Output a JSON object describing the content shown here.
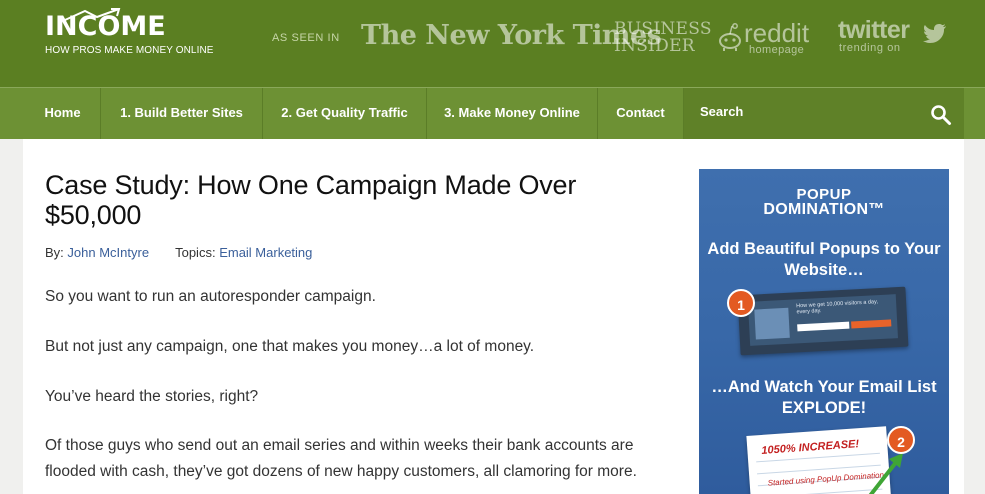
{
  "header": {
    "logo_text": "INCOME",
    "logo_tagline": "HOW PROS MAKE MONEY ONLINE",
    "as_seen_in": "AS SEEN IN",
    "press": {
      "nyt": "The New York Times",
      "bi_line1": "BUSINESS",
      "bi_line2": "INSIDER",
      "reddit_word": "reddit",
      "reddit_sub": "homepage",
      "twitter_word": "twitter",
      "twitter_sub": "trending on"
    }
  },
  "nav": {
    "items": [
      {
        "label": "Home"
      },
      {
        "label": "1. Build Better Sites"
      },
      {
        "label": "2. Get Quality Traffic"
      },
      {
        "label": "3. Make Money Online"
      },
      {
        "label": "Contact"
      }
    ],
    "search_placeholder": "Search"
  },
  "article": {
    "title": "Case Study: How One Campaign Made Over $50,000",
    "by_label": "By:",
    "author": "John McIntyre",
    "topics_label": "Topics:",
    "topic": "Email Marketing",
    "paragraphs": [
      "So you want to run an autoresponder campaign.",
      "But not just any campaign, one that makes you money…a lot of money.",
      "You’ve heard the stories, right?",
      "Of those guys who send out an email series and within weeks their bank accounts are flooded with cash, they’ve got dozens of new happy customers, all clamoring for more."
    ]
  },
  "ad": {
    "brand_top": "POPUP",
    "brand_main": "DOMINATION™",
    "headline1": "Add Beautiful Popups to Your Website…",
    "headline2": "…And Watch Your Email List EXPLODE!",
    "shot_text": "How we get 10,000 visitors a day, every day.",
    "badge1": "1",
    "badge2": "2",
    "increase": "1050% INCREASE!",
    "started": "Started using PopUp Domination"
  },
  "colors": {
    "header_bg": "#5b7f22",
    "nav_bg": "#6d9134",
    "link": "#3a5f9a",
    "ad_bg": "#3868a8",
    "badge": "#e35a22"
  }
}
